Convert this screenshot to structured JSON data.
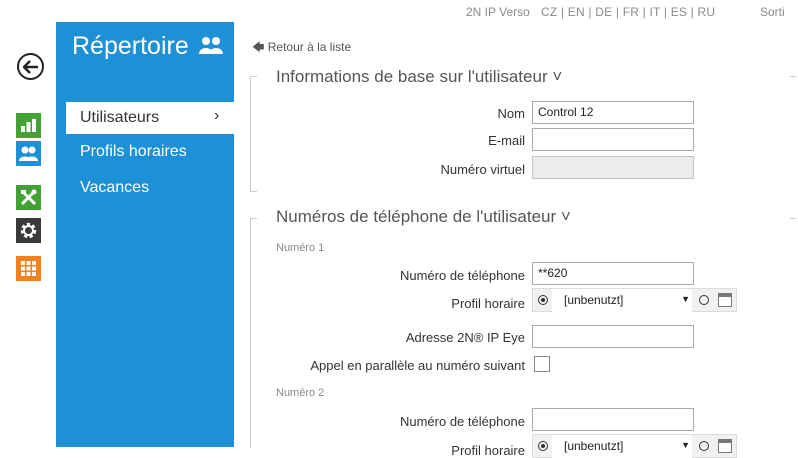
{
  "topbar": {
    "device": "2N IP Verso",
    "languages": "CZ | EN | DE | FR | IT | ES | RU",
    "logout": "Sorti"
  },
  "sidebar_icons": [
    {
      "name": "back-arrow-icon"
    },
    {
      "name": "status-chart-icon",
      "color": "#43a135"
    },
    {
      "name": "directory-users-icon",
      "color": "#1e90d6"
    },
    {
      "name": "hardware-tools-icon",
      "color": "#43a135"
    },
    {
      "name": "settings-gear-icon",
      "color": "#3a3a3a"
    },
    {
      "name": "services-grid-icon",
      "color": "#f08221"
    }
  ],
  "panel": {
    "title": "Répertoire",
    "accent": "#1e90d6",
    "nav": [
      {
        "label": "Utilisateurs",
        "active": true
      },
      {
        "label": "Profils horaires"
      },
      {
        "label": "Vacances"
      }
    ],
    "chevron": "›"
  },
  "main": {
    "back_link": "Retour à la liste",
    "basic_info": {
      "title": "Informations de base sur l'utilisateur",
      "toggle": "˅",
      "fields": [
        {
          "label": "Nom",
          "value": "Control 12"
        },
        {
          "label": "E-mail",
          "value": ""
        },
        {
          "label": "Numéro virtuel",
          "value": ""
        }
      ]
    },
    "phones": {
      "title": "Numéros de téléphone de l'utilisateur",
      "toggle": "˅",
      "number1": {
        "heading": "Numéro 1",
        "phone_label": "Numéro de téléphone",
        "phone_value": "**620",
        "profile_label": "Profil horaire",
        "profile_value": "[unbenutzt]",
        "eye_label": "Adresse 2N® IP Eye",
        "eye_value": "",
        "parallel_label": "Appel en parallèle au numéro suivant"
      },
      "number2": {
        "heading": "Numéro 2",
        "phone_label": "Numéro de téléphone",
        "phone_value": "",
        "profile_label": "Profil horaire",
        "profile_value": "[unbenutzt]"
      }
    }
  }
}
